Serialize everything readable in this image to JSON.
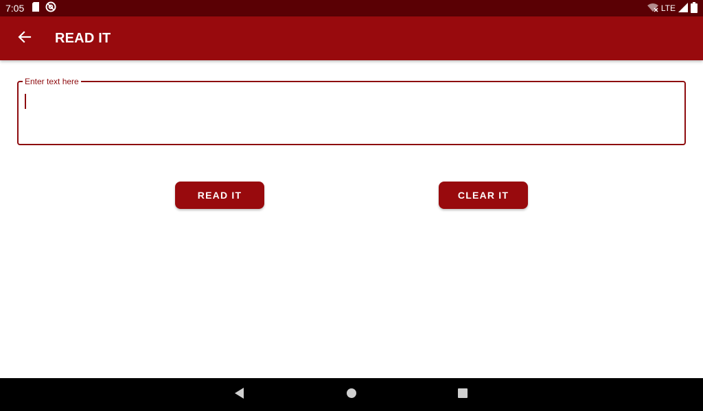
{
  "status_bar": {
    "time": "7:05",
    "network_label": "LTE",
    "left_icons": [
      "sd-card-icon",
      "sync-circle-icon"
    ],
    "right_icons": [
      "wifi-off-icon",
      "cell-signal-icon",
      "battery-icon"
    ]
  },
  "app_bar": {
    "title": "READ IT",
    "back_icon": "arrow-back-icon",
    "color": "#980a0d"
  },
  "text_field": {
    "label": "Enter text here",
    "value": "",
    "accent": "#8d0a0d"
  },
  "buttons": {
    "read": "READ IT",
    "clear": "CLEAR IT"
  },
  "nav_bar": {
    "icons": [
      "back-triangle-icon",
      "home-circle-icon",
      "recents-square-icon"
    ]
  },
  "colors": {
    "status_bar": "#5a0004",
    "primary": "#980a0d",
    "nav_bar": "#000000"
  }
}
